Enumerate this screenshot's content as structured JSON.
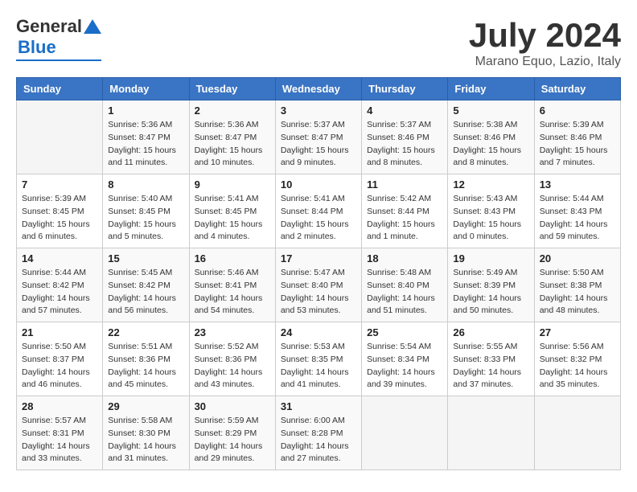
{
  "header": {
    "logo": {
      "general": "General",
      "blue": "Blue"
    },
    "title": "July 2024",
    "location": "Marano Equo, Lazio, Italy"
  },
  "days_of_week": [
    "Sunday",
    "Monday",
    "Tuesday",
    "Wednesday",
    "Thursday",
    "Friday",
    "Saturday"
  ],
  "weeks": [
    [
      {
        "day": "",
        "info": ""
      },
      {
        "day": "1",
        "info": "Sunrise: 5:36 AM\nSunset: 8:47 PM\nDaylight: 15 hours\nand 11 minutes."
      },
      {
        "day": "2",
        "info": "Sunrise: 5:36 AM\nSunset: 8:47 PM\nDaylight: 15 hours\nand 10 minutes."
      },
      {
        "day": "3",
        "info": "Sunrise: 5:37 AM\nSunset: 8:47 PM\nDaylight: 15 hours\nand 9 minutes."
      },
      {
        "day": "4",
        "info": "Sunrise: 5:37 AM\nSunset: 8:46 PM\nDaylight: 15 hours\nand 8 minutes."
      },
      {
        "day": "5",
        "info": "Sunrise: 5:38 AM\nSunset: 8:46 PM\nDaylight: 15 hours\nand 8 minutes."
      },
      {
        "day": "6",
        "info": "Sunrise: 5:39 AM\nSunset: 8:46 PM\nDaylight: 15 hours\nand 7 minutes."
      }
    ],
    [
      {
        "day": "7",
        "info": "Sunrise: 5:39 AM\nSunset: 8:45 PM\nDaylight: 15 hours\nand 6 minutes."
      },
      {
        "day": "8",
        "info": "Sunrise: 5:40 AM\nSunset: 8:45 PM\nDaylight: 15 hours\nand 5 minutes."
      },
      {
        "day": "9",
        "info": "Sunrise: 5:41 AM\nSunset: 8:45 PM\nDaylight: 15 hours\nand 4 minutes."
      },
      {
        "day": "10",
        "info": "Sunrise: 5:41 AM\nSunset: 8:44 PM\nDaylight: 15 hours\nand 2 minutes."
      },
      {
        "day": "11",
        "info": "Sunrise: 5:42 AM\nSunset: 8:44 PM\nDaylight: 15 hours\nand 1 minute."
      },
      {
        "day": "12",
        "info": "Sunrise: 5:43 AM\nSunset: 8:43 PM\nDaylight: 15 hours\nand 0 minutes."
      },
      {
        "day": "13",
        "info": "Sunrise: 5:44 AM\nSunset: 8:43 PM\nDaylight: 14 hours\nand 59 minutes."
      }
    ],
    [
      {
        "day": "14",
        "info": "Sunrise: 5:44 AM\nSunset: 8:42 PM\nDaylight: 14 hours\nand 57 minutes."
      },
      {
        "day": "15",
        "info": "Sunrise: 5:45 AM\nSunset: 8:42 PM\nDaylight: 14 hours\nand 56 minutes."
      },
      {
        "day": "16",
        "info": "Sunrise: 5:46 AM\nSunset: 8:41 PM\nDaylight: 14 hours\nand 54 minutes."
      },
      {
        "day": "17",
        "info": "Sunrise: 5:47 AM\nSunset: 8:40 PM\nDaylight: 14 hours\nand 53 minutes."
      },
      {
        "day": "18",
        "info": "Sunrise: 5:48 AM\nSunset: 8:40 PM\nDaylight: 14 hours\nand 51 minutes."
      },
      {
        "day": "19",
        "info": "Sunrise: 5:49 AM\nSunset: 8:39 PM\nDaylight: 14 hours\nand 50 minutes."
      },
      {
        "day": "20",
        "info": "Sunrise: 5:50 AM\nSunset: 8:38 PM\nDaylight: 14 hours\nand 48 minutes."
      }
    ],
    [
      {
        "day": "21",
        "info": "Sunrise: 5:50 AM\nSunset: 8:37 PM\nDaylight: 14 hours\nand 46 minutes."
      },
      {
        "day": "22",
        "info": "Sunrise: 5:51 AM\nSunset: 8:36 PM\nDaylight: 14 hours\nand 45 minutes."
      },
      {
        "day": "23",
        "info": "Sunrise: 5:52 AM\nSunset: 8:36 PM\nDaylight: 14 hours\nand 43 minutes."
      },
      {
        "day": "24",
        "info": "Sunrise: 5:53 AM\nSunset: 8:35 PM\nDaylight: 14 hours\nand 41 minutes."
      },
      {
        "day": "25",
        "info": "Sunrise: 5:54 AM\nSunset: 8:34 PM\nDaylight: 14 hours\nand 39 minutes."
      },
      {
        "day": "26",
        "info": "Sunrise: 5:55 AM\nSunset: 8:33 PM\nDaylight: 14 hours\nand 37 minutes."
      },
      {
        "day": "27",
        "info": "Sunrise: 5:56 AM\nSunset: 8:32 PM\nDaylight: 14 hours\nand 35 minutes."
      }
    ],
    [
      {
        "day": "28",
        "info": "Sunrise: 5:57 AM\nSunset: 8:31 PM\nDaylight: 14 hours\nand 33 minutes."
      },
      {
        "day": "29",
        "info": "Sunrise: 5:58 AM\nSunset: 8:30 PM\nDaylight: 14 hours\nand 31 minutes."
      },
      {
        "day": "30",
        "info": "Sunrise: 5:59 AM\nSunset: 8:29 PM\nDaylight: 14 hours\nand 29 minutes."
      },
      {
        "day": "31",
        "info": "Sunrise: 6:00 AM\nSunset: 8:28 PM\nDaylight: 14 hours\nand 27 minutes."
      },
      {
        "day": "",
        "info": ""
      },
      {
        "day": "",
        "info": ""
      },
      {
        "day": "",
        "info": ""
      }
    ]
  ]
}
